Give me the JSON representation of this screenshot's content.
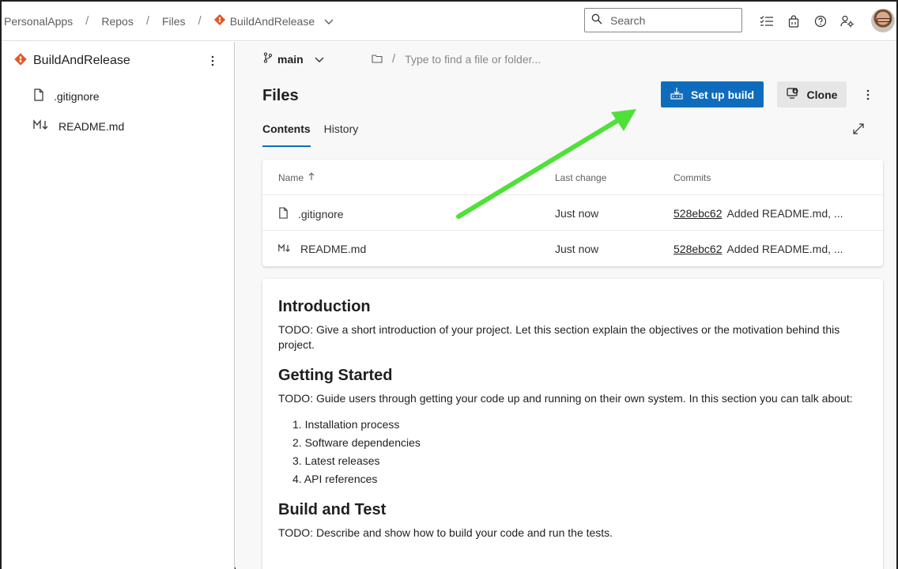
{
  "breadcrumbs": {
    "org": "PersonalApps",
    "section": "Repos",
    "page": "Files",
    "repo": "BuildAndRelease",
    "separator": "/"
  },
  "search": {
    "placeholder": "Search"
  },
  "top_icons": [
    "task-list-icon",
    "shopping-bag-icon",
    "help-icon",
    "user-settings-icon"
  ],
  "sidebar": {
    "repo_name": "BuildAndRelease",
    "items": [
      {
        "label": ".gitignore",
        "icon": "file-icon"
      },
      {
        "label": "README.md",
        "icon": "markdown-icon"
      }
    ]
  },
  "main": {
    "branch": "main",
    "path_placeholder": "Type to find a file or folder...",
    "title": "Files",
    "setup_build_label": "Set up build",
    "clone_label": "Clone",
    "tabs": [
      {
        "label": "Contents",
        "active": true
      },
      {
        "label": "History",
        "active": false
      }
    ],
    "table": {
      "columns": [
        "Name",
        "Last change",
        "Commits"
      ],
      "rows": [
        {
          "name": ".gitignore",
          "icon": "file-icon",
          "last_change": "Just now",
          "commit": "528ebc62",
          "message": "Added README.md, ..."
        },
        {
          "name": "README.md",
          "icon": "markdown-icon",
          "last_change": "Just now",
          "commit": "528ebc62",
          "message": "Added README.md, ..."
        }
      ]
    }
  },
  "readme": {
    "intro_heading": "Introduction",
    "intro_text": "TODO: Give a short introduction of your project. Let this section explain the objectives or the motivation behind this project.",
    "getting_started_heading": "Getting Started",
    "getting_started_text": "TODO: Guide users through getting your code up and running on their own system. In this section you can talk about:",
    "list": [
      "1. Installation process",
      "2. Software dependencies",
      "3. Latest releases",
      "4. API references"
    ],
    "build_heading": "Build and Test",
    "build_text": "TODO: Describe and show how to build your code and run the tests."
  },
  "colors": {
    "primary": "#0f6cbd",
    "repo_icon": "#e05b2c",
    "annotation_arrow": "#4fe03a"
  }
}
